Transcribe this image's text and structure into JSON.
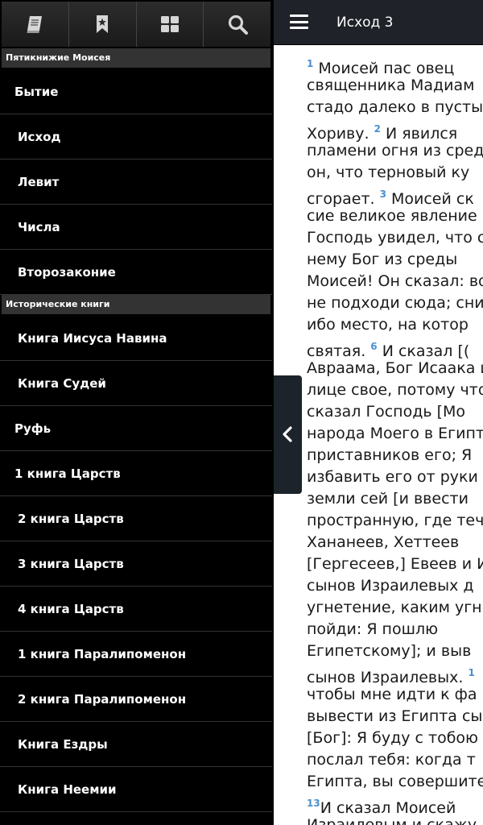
{
  "reader": {
    "title": "Исход 3",
    "lines": [
      {
        "v": "1",
        "t": " Моисей пас овец"
      },
      {
        "t": "священника Мадиам"
      },
      {
        "t": "стадо далеко в пусты"
      },
      {
        "t": "Хориву. ",
        "v": "2",
        "after": " И явился"
      },
      {
        "t": "пламени огня из сред"
      },
      {
        "t": "он, что терновый ку"
      },
      {
        "t": "сгорает. ",
        "v": "3",
        "after": " Моисей ск"
      },
      {
        "t": "сие великое явление"
      },
      {
        "t": "Господь увидел, что с"
      },
      {
        "t": "нему Бог из среды"
      },
      {
        "t": "Моисей! Он сказал: во"
      },
      {
        "t": "не подходи сюда; сни"
      },
      {
        "t": "ибо место, на котор"
      },
      {
        "t": "святая. ",
        "v": "6",
        "after": " И сказал [("
      },
      {
        "t": "Авраама, Бог Исаака и"
      },
      {
        "t": "лице свое, потому что"
      },
      {
        "t": "сказал Господь [Мо"
      },
      {
        "t": "народа Моего в Египт"
      },
      {
        "t": "приставников его; Я"
      },
      {
        "t": "избавить его от руки"
      },
      {
        "t": "земли сей [и ввести"
      },
      {
        "t": "пространную, где теч"
      },
      {
        "t": "Хананеев,    Хеттеев"
      },
      {
        "t": "[Гергесеев,] Евеев и И"
      },
      {
        "t": "сынов Израилевых д"
      },
      {
        "t": "угнетение, каким угн"
      },
      {
        "t": "пойди:  Я  пошлю"
      },
      {
        "t": "Египетскому]; и выв"
      },
      {
        "t": "сынов Израилевых. ",
        "v": "1",
        "after": ""
      },
      {
        "t": "чтобы мне идти к фа"
      },
      {
        "t": "вывести из Египта сы"
      },
      {
        "t": "[Бог]: Я буду с тобою"
      },
      {
        "t": "послал тебя: когда т"
      },
      {
        "t": "Египта, вы совершите"
      },
      {
        "v": "13",
        "t": "И сказал Моисей"
      },
      {
        "t": "Израилевым и скажу"
      }
    ]
  },
  "tabs": [
    {
      "name": "book-tab",
      "icon": "book-icon"
    },
    {
      "name": "bookmark-tab",
      "icon": "bookmark-icon"
    },
    {
      "name": "grid-tab",
      "icon": "grid-icon"
    },
    {
      "name": "search-tab",
      "icon": "search-icon"
    }
  ],
  "sections": [
    {
      "title": "Пятикнижие Моисея",
      "books": [
        "Бытие",
        "Исход",
        "Левит",
        "Числа",
        "Второзаконие"
      ]
    },
    {
      "title": "Исторические книги",
      "books": [
        "Книга Иисуса Навина",
        "Книга Судей",
        "Руфь",
        "1 книга Царств",
        "2 книга Царств",
        "3 книга Царств",
        "4 книга Царств",
        "1 книга Паралипоменон",
        "2 книга Паралипоменон",
        "Книга Ездры",
        "Книга Неемии"
      ]
    }
  ]
}
